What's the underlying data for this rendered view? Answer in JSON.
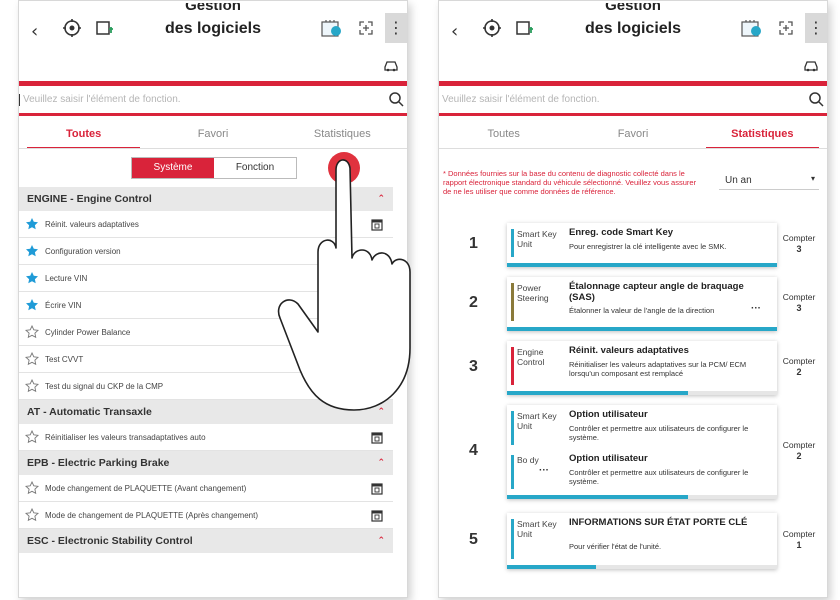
{
  "header": {
    "title_top": "Gestion",
    "title_bottom": "des logiciels",
    "back_icon": "chevron-left-icon",
    "icon_1": "gear-diagnostic-icon",
    "icon_2": "vehicle-download-icon",
    "icon_3": "ecu-update-icon",
    "icon_4": "expand-icon",
    "menu_icon": "more-vertical-icon",
    "car_icon": "car-icon",
    "menu_glyph": "⋮",
    "back_glyph": "‹"
  },
  "search": {
    "placeholder": "Veuillez saisir l'élément de fonction."
  },
  "tabs": [
    "Toutes",
    "Favori",
    "Statistiques"
  ],
  "left_panel": {
    "active_tab": 0,
    "segment": [
      "Système",
      "Fonction"
    ],
    "groups": [
      {
        "name": "ENGINE - Engine Control",
        "items": [
          {
            "label": "Réinit. valeurs adaptatives",
            "fav": true,
            "cal": true
          },
          {
            "label": "Configuration version",
            "fav": true,
            "cal": false
          },
          {
            "label": "Lecture VIN",
            "fav": true,
            "cal": false
          },
          {
            "label": "Écrire VIN",
            "fav": true,
            "cal": false
          },
          {
            "label": "Cylinder Power Balance",
            "fav": false,
            "cal": false
          },
          {
            "label": "Test CVVT",
            "fav": false,
            "cal": false
          },
          {
            "label": "Test du signal du CKP de la CMP",
            "fav": false,
            "cal": false
          }
        ]
      },
      {
        "name": "AT - Automatic Transaxle",
        "items": [
          {
            "label": "Réinitialiser les valeurs transadaptatives auto",
            "fav": false,
            "cal": true
          }
        ]
      },
      {
        "name": "EPB - Electric Parking Brake",
        "items": [
          {
            "label": "Mode changement de PLAQUETTE (Avant changement)",
            "fav": false,
            "cal": true
          },
          {
            "label": "Mode de changement de PLAQUETTE (Après changement)",
            "fav": false,
            "cal": true
          }
        ]
      },
      {
        "name": "ESC - Electronic Stability Control",
        "items": []
      }
    ]
  },
  "right_panel": {
    "active_tab": 2,
    "note": "* Données fournies sur la base du contenu de diagnostic collecté dans le rapport électronique standard du véhicule sélectionné. Veuillez vous assurer de ne les utiliser que comme données de référence.",
    "period": "Un an",
    "period_caret": "▾",
    "count_label": "Compter",
    "rankings": [
      {
        "rank": "1",
        "entries": [
          {
            "unit": "Smart Key Unit",
            "unit_color": "#27a7c8",
            "title": "Enreg. code Smart Key",
            "desc": "Pour enregistrer la clé intelligente avec le SMK."
          }
        ],
        "count": "3",
        "progress": 1.0
      },
      {
        "rank": "2",
        "entries": [
          {
            "unit": "Power Steering",
            "unit_color": "#8a7a3a",
            "title": "Étalonnage capteur angle de braquage (SAS)",
            "desc": "Étalonner la valeur de l'angle de la direction",
            "more": "···"
          }
        ],
        "count": "3",
        "progress": 1.0
      },
      {
        "rank": "3",
        "entries": [
          {
            "unit": "Engine Control",
            "unit_color": "#d9233a",
            "title": "Réinit. valeurs adaptatives",
            "desc": "Réinitialiser les valeurs adaptatives sur la PCM/ ECM lorsqu'un composant est remplacé"
          }
        ],
        "count": "2",
        "progress": 0.67
      },
      {
        "rank": "4",
        "entries": [
          {
            "unit": "Smart Key Unit",
            "unit_color": "#27a7c8",
            "title": "Option utilisateur",
            "desc": "Contrôler et permettre aux utilisateurs de configurer le système."
          },
          {
            "unit": "Bo dy",
            "unit_color": "#27a7c8",
            "title": "Option utilisateur",
            "desc": "Contrôler et permettre aux utilisateurs de configurer le système.",
            "more": "···"
          }
        ],
        "count": "2",
        "progress": 0.67
      },
      {
        "rank": "5",
        "entries": [
          {
            "unit": "Smart Key Unit",
            "unit_color": "#27a7c8",
            "title": "INFORMATIONS SUR ÉTAT PORTE CLÉ",
            "desc": "Pour vérifier l'état de l'unité."
          }
        ],
        "count": "1",
        "progress": 0.33
      }
    ]
  },
  "colors": {
    "accent": "#d9233a",
    "progress": "#27a7c8",
    "star_filled": "#1f9bd7"
  },
  "overlay": {
    "icon": "tap-hand-pointer-icon"
  }
}
